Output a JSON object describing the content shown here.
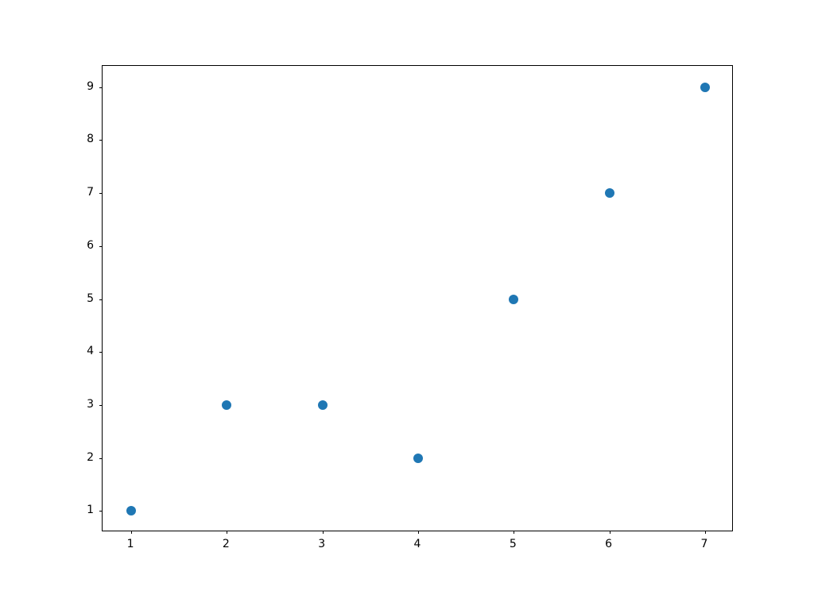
{
  "chart_data": {
    "type": "scatter",
    "x": [
      1,
      2,
      3,
      4,
      5,
      6,
      7
    ],
    "y": [
      1,
      3,
      3,
      2,
      5,
      7,
      9
    ],
    "title": "",
    "xlabel": "",
    "ylabel": "",
    "xticks": [
      1,
      2,
      3,
      4,
      5,
      6,
      7
    ],
    "yticks": [
      1,
      2,
      3,
      4,
      5,
      6,
      7,
      8,
      9
    ],
    "xlim": [
      0.7,
      7.3
    ],
    "ylim": [
      0.6,
      9.4
    ],
    "marker_color": "#1f77b4"
  }
}
